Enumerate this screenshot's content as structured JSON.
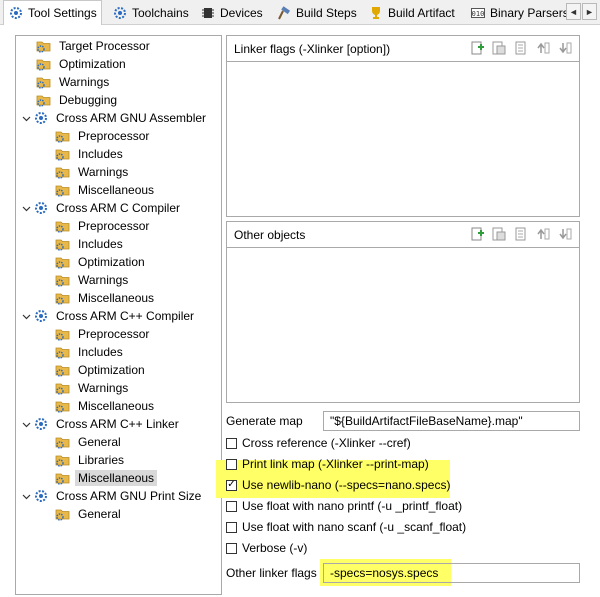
{
  "tabs": [
    {
      "label": "Tool Settings",
      "icon": "gear-icon",
      "active": true
    },
    {
      "label": "Toolchains",
      "icon": "gear-icon",
      "active": false
    },
    {
      "label": "Devices",
      "icon": "chip-icon",
      "active": false
    },
    {
      "label": "Build Steps",
      "icon": "hammer-icon",
      "active": false
    },
    {
      "label": "Build Artifact",
      "icon": "trophy-icon",
      "active": false
    },
    {
      "label": "Binary Parsers",
      "icon": "binary-icon",
      "active": false
    }
  ],
  "tab_scroll": {
    "left": "◄",
    "right": "►"
  },
  "tree": [
    {
      "label": "Target Processor",
      "level": 1,
      "expanded": null
    },
    {
      "label": "Optimization",
      "level": 1,
      "expanded": null
    },
    {
      "label": "Warnings",
      "level": 1,
      "expanded": null
    },
    {
      "label": "Debugging",
      "level": 1,
      "expanded": null
    },
    {
      "label": "Cross ARM GNU Assembler",
      "level": 0,
      "expanded": true
    },
    {
      "label": "Preprocessor",
      "level": 2,
      "expanded": null
    },
    {
      "label": "Includes",
      "level": 2,
      "expanded": null
    },
    {
      "label": "Warnings",
      "level": 2,
      "expanded": null
    },
    {
      "label": "Miscellaneous",
      "level": 2,
      "expanded": null
    },
    {
      "label": "Cross ARM C Compiler",
      "level": 0,
      "expanded": true
    },
    {
      "label": "Preprocessor",
      "level": 2,
      "expanded": null
    },
    {
      "label": "Includes",
      "level": 2,
      "expanded": null
    },
    {
      "label": "Optimization",
      "level": 2,
      "expanded": null
    },
    {
      "label": "Warnings",
      "level": 2,
      "expanded": null
    },
    {
      "label": "Miscellaneous",
      "level": 2,
      "expanded": null
    },
    {
      "label": "Cross ARM C++ Compiler",
      "level": 0,
      "expanded": true
    },
    {
      "label": "Preprocessor",
      "level": 2,
      "expanded": null
    },
    {
      "label": "Includes",
      "level": 2,
      "expanded": null
    },
    {
      "label": "Optimization",
      "level": 2,
      "expanded": null
    },
    {
      "label": "Warnings",
      "level": 2,
      "expanded": null
    },
    {
      "label": "Miscellaneous",
      "level": 2,
      "expanded": null
    },
    {
      "label": "Cross ARM C++ Linker",
      "level": 0,
      "expanded": true
    },
    {
      "label": "General",
      "level": 2,
      "expanded": null
    },
    {
      "label": "Libraries",
      "level": 2,
      "expanded": null
    },
    {
      "label": "Miscellaneous",
      "level": 2,
      "expanded": null,
      "selected": true
    },
    {
      "label": "Cross ARM GNU Print Size",
      "level": 0,
      "expanded": true
    },
    {
      "label": "General",
      "level": 2,
      "expanded": null
    }
  ],
  "linker_flags": {
    "title": "Linker flags (-Xlinker [option])"
  },
  "other_objects": {
    "title": "Other objects"
  },
  "list_tools": [
    "add-icon",
    "add-from-workspace-icon",
    "edit-icon",
    "move-up-icon",
    "move-down-icon"
  ],
  "generate_map": {
    "label": "Generate map",
    "value": "\"${BuildArtifactFileBaseName}.map\""
  },
  "checkboxes": [
    {
      "label": "Cross reference (-Xlinker --cref)",
      "checked": false,
      "highlight": false
    },
    {
      "label": "Print link map (-Xlinker --print-map)",
      "checked": false,
      "highlight": true
    },
    {
      "label": "Use newlib-nano (--specs=nano.specs)",
      "checked": true,
      "highlight": true
    },
    {
      "label": "Use float with nano printf (-u _printf_float)",
      "checked": false,
      "highlight": false
    },
    {
      "label": "Use float with nano scanf (-u _scanf_float)",
      "checked": false,
      "highlight": false
    },
    {
      "label": "Verbose (-v)",
      "checked": false,
      "highlight": false
    }
  ],
  "other_linker_flags": {
    "label": "Other linker flags",
    "value": "-specs=nosys.specs"
  },
  "colors": {
    "highlight": "#ffff66",
    "folder": "#e8b84a",
    "gear": "#2a6bc0"
  }
}
